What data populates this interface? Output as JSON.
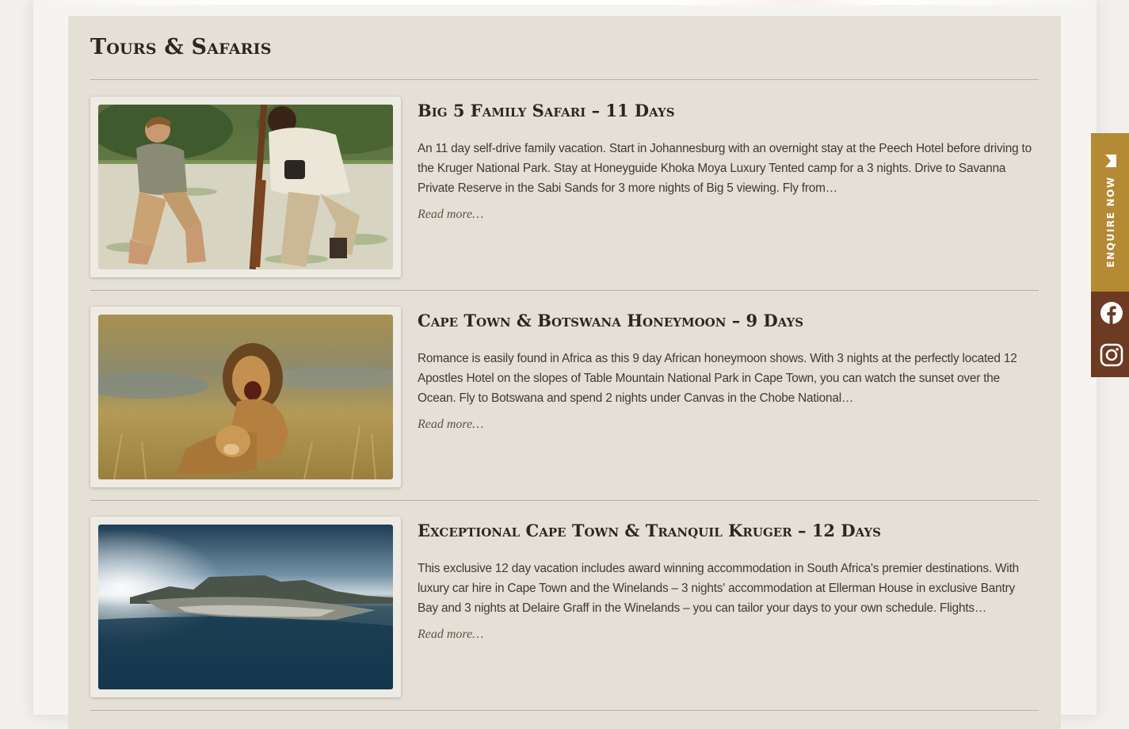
{
  "section": {
    "title": "Tours & Safaris"
  },
  "tours": [
    {
      "title": "Big 5 Family Safari – 11 Days",
      "description": "An 11 day self-drive family vacation. Start in Johannesburg with an overnight stay at the Peech Hotel before driving to the Kruger National Park. Stay at Honeyguide Khoka Moya Luxury Tented camp for a 3 nights. Drive to Savanna Private Reserve in the Sabi Sands for 3 more nights of Big 5 viewing. Fly from…",
      "read_more": "Read more…",
      "image": "safari-guide-with-boy"
    },
    {
      "title": "Cape Town & Botswana Honeymoon – 9 Days",
      "description": "Romance is easily found in Africa as this 9 day African honeymoon shows. With 3 nights at the perfectly located 12 Apostles Hotel on the slopes of Table Mountain National Park in Cape Town, you can watch the sunset over the Ocean. Fly to Botswana and spend 2 nights under Canvas in the Chobe National…",
      "read_more": "Read more…",
      "image": "lion-pair"
    },
    {
      "title": "Exceptional Cape Town & Tranquil Kruger – 12 Days",
      "description": "This exclusive 12 day vacation includes award winning accommodation in South Africa's premier destinations. With luxury car hire in Cape Town and the Winelands – 3 nights' accommodation at Ellerman House in exclusive Bantry Bay and 3 nights at Delaire Graff in the Winelands – you can tailor your days to your own schedule. Flights…",
      "read_more": "Read more…",
      "image": "cape-town-aerial"
    }
  ],
  "side_widget": {
    "enquire_label": "ENQUIRE NOW",
    "icons": [
      "mail-icon",
      "facebook-icon",
      "instagram-icon"
    ]
  },
  "colors": {
    "panel": "#e4e0d6",
    "enquire": "#b58a34",
    "social": "#6d3a22",
    "heading": "#2a2623"
  }
}
